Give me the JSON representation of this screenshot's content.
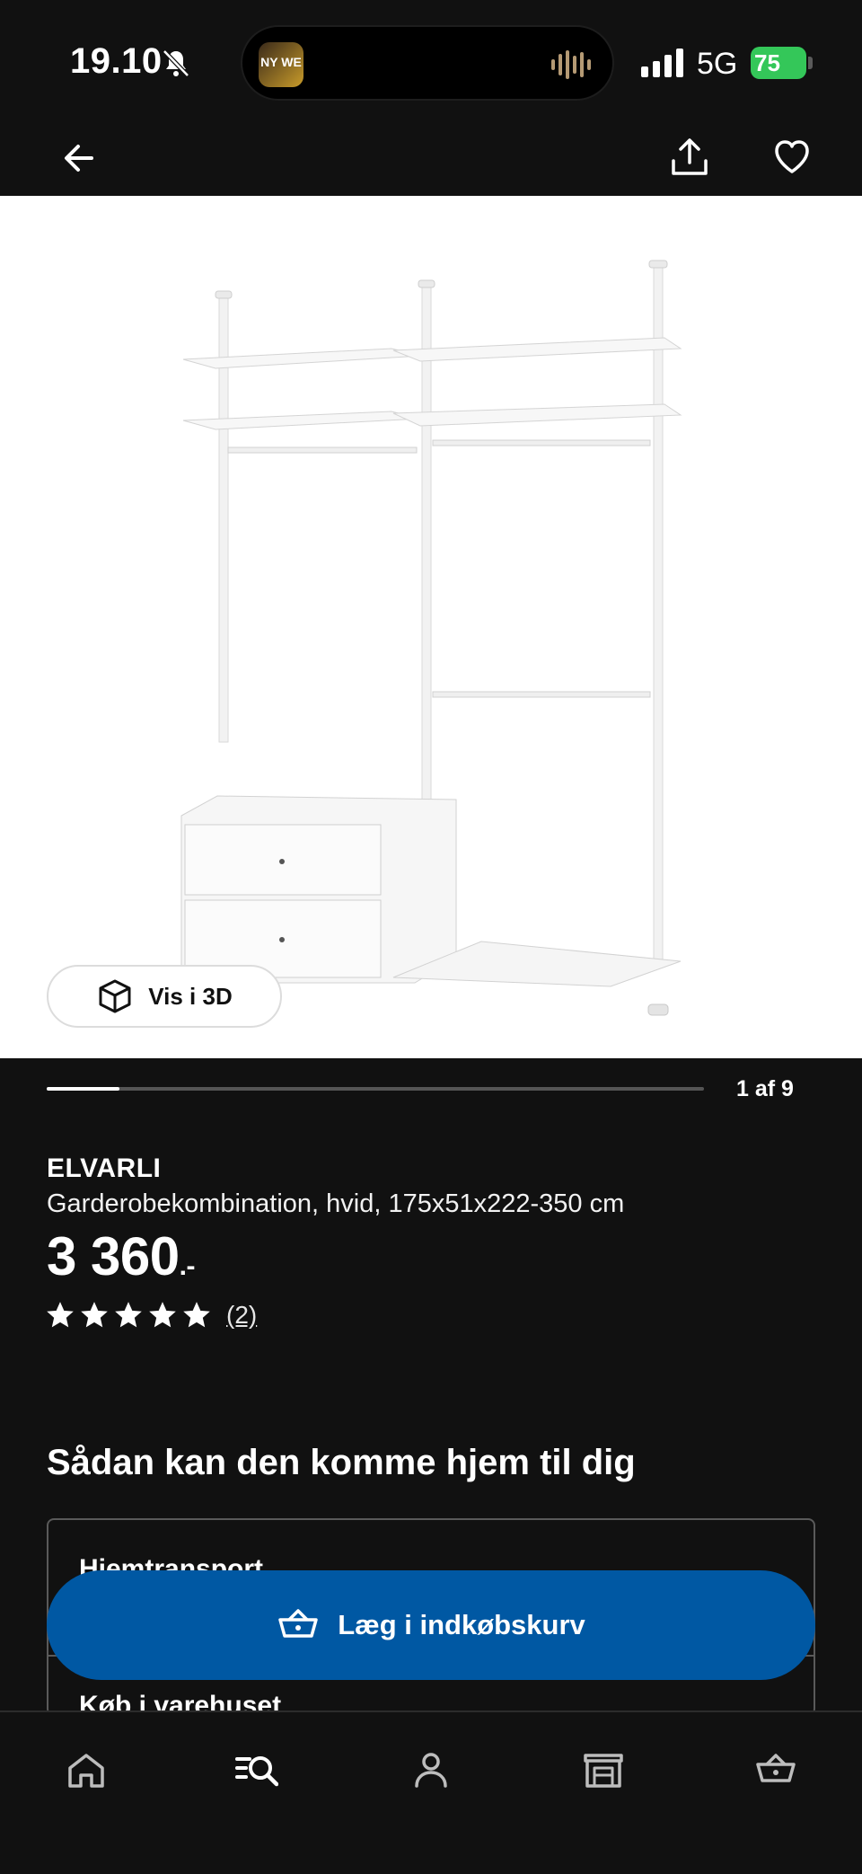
{
  "status_bar": {
    "time": "19.10",
    "network": "5G",
    "battery": "75",
    "island_app_text": "NY WE"
  },
  "icons": {
    "back": "arrow-left-icon",
    "share": "share-icon",
    "wishlist": "heart-icon",
    "view_3d": "cube-icon",
    "cart": "basket-icon",
    "home": "home-icon",
    "browse": "search-list-icon",
    "account": "person-icon",
    "stores": "store-icon",
    "basket": "basket-icon"
  },
  "media": {
    "view_3d_label": "Vis i 3D",
    "carousel_counter": "1 af 9",
    "current_index": 1,
    "total_images": 9
  },
  "product": {
    "name": "ELVARLI",
    "description": "Garderobekombination, hvid, 175x51x222-350 cm",
    "price": "3 360",
    "price_suffix": ".-",
    "rating_value": 5,
    "rating_max": 5,
    "review_count": "(2)"
  },
  "delivery": {
    "heading": "Sådan kan den komme hjem til dig",
    "options": [
      "Hjemtransport",
      "Køb i varehuset"
    ]
  },
  "cta": {
    "add_to_cart_label": "Læg i indkøbskurv"
  },
  "colors": {
    "background": "#111111",
    "accent_blue": "#0058a3",
    "battery_green": "#34c759"
  }
}
